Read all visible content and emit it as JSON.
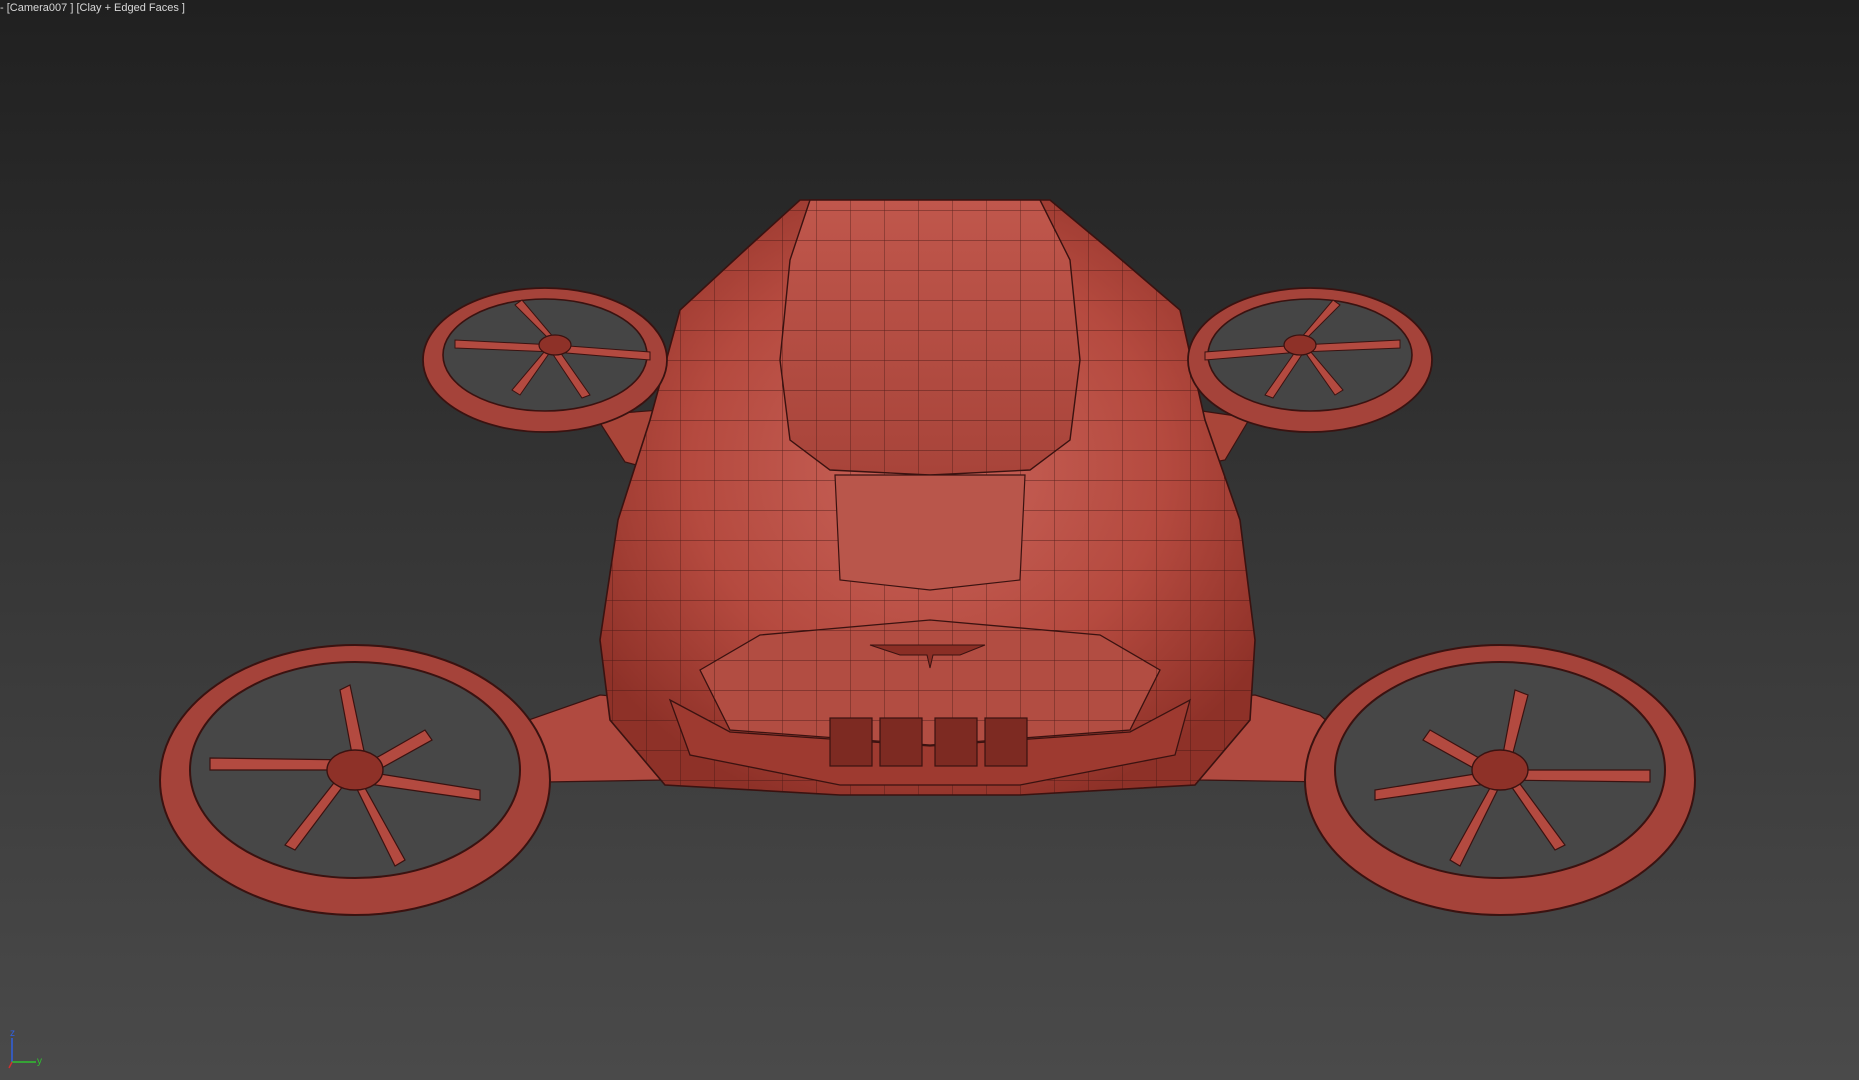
{
  "viewport": {
    "label_prefix": "-",
    "label_camera": "[Camera007 ]",
    "label_shading": "[Clay + Edged Faces ]",
    "shading_mode": "Clay + Edged Faces",
    "model_color": "#b7473c",
    "wire_color": "#3a1210",
    "background_top": "#202020",
    "background_bottom": "#4a4a4a"
  },
  "gizmo": {
    "axis_z": "z",
    "axis_x": "x",
    "axis_y": "y",
    "colors": {
      "x": "#d03030",
      "y": "#30c030",
      "z": "#3060e0"
    }
  },
  "icons": [
    "view-axis-gizmo-icon"
  ]
}
